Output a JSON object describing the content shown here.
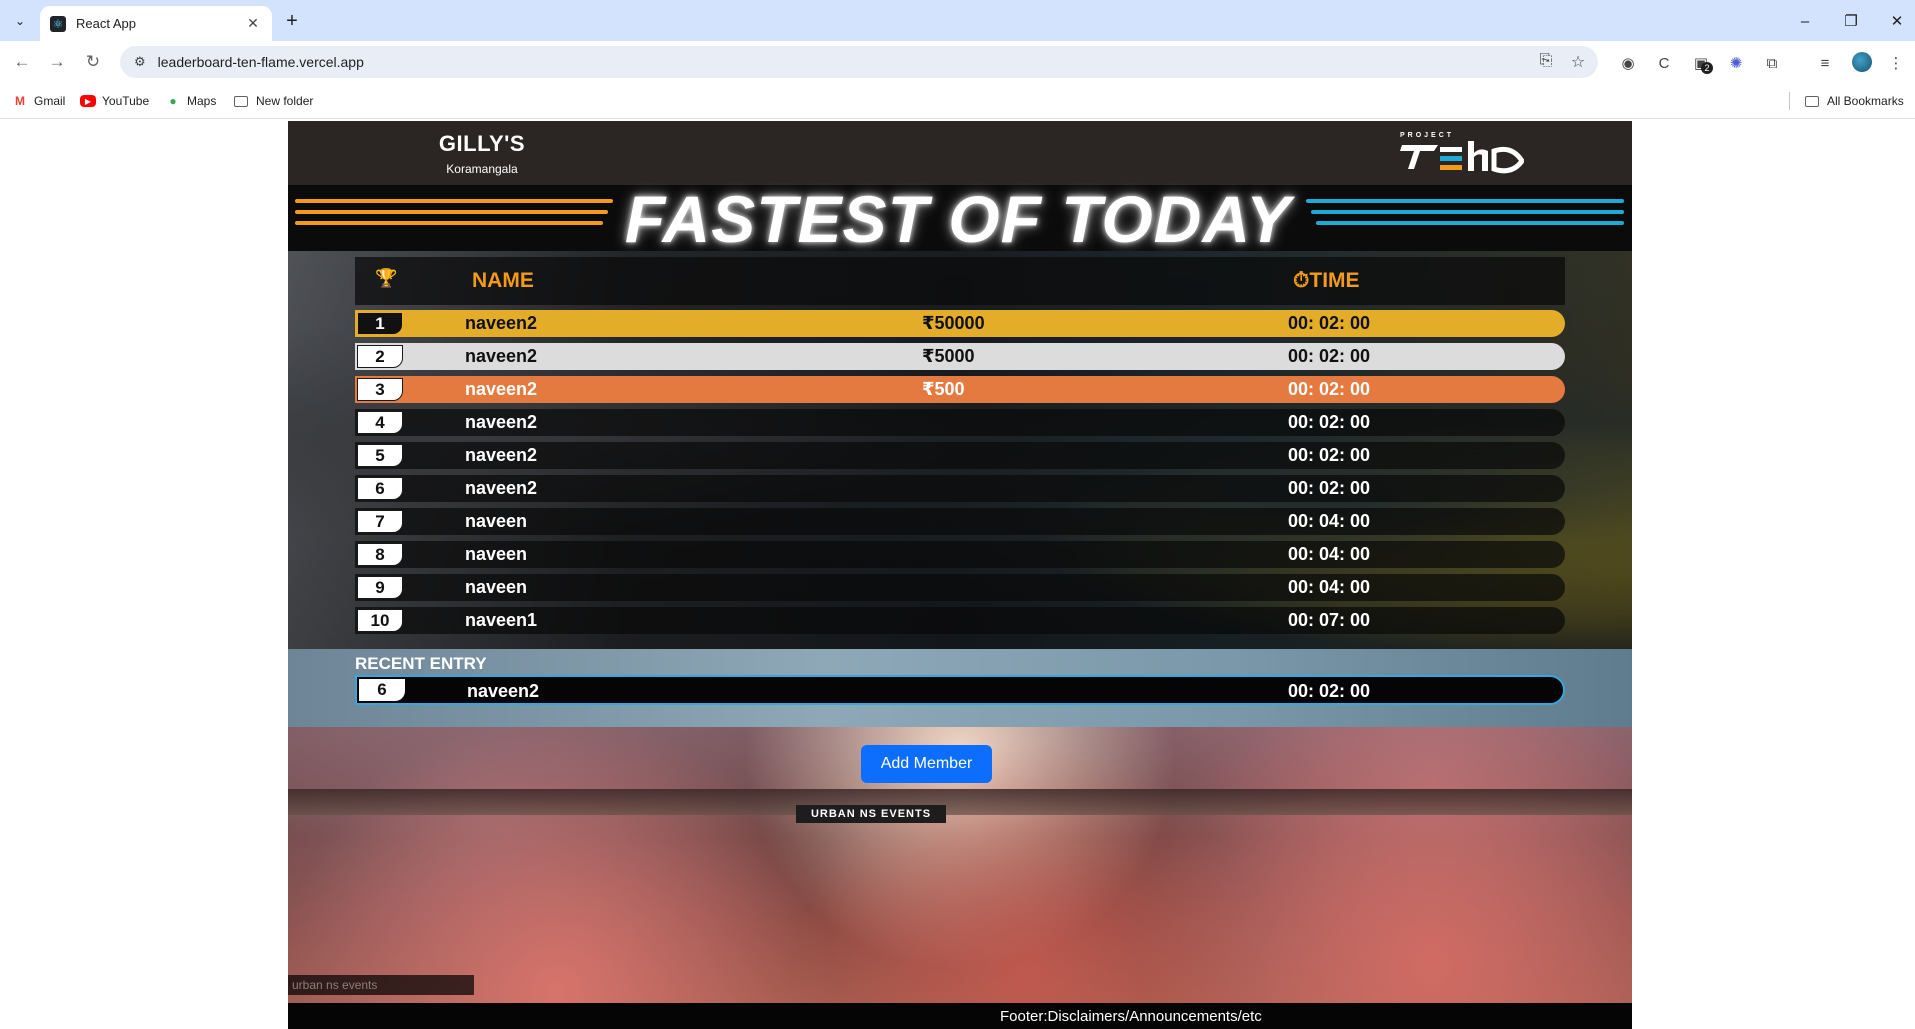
{
  "browser": {
    "tab_title": "React App",
    "url": "leaderboard-ten-flame.vercel.app",
    "bookmarks": [
      "Gmail",
      "YouTube",
      "Maps",
      "New folder"
    ],
    "all_bookmarks": "All Bookmarks",
    "extension_badge": "2"
  },
  "header": {
    "venue": "GILLY'S",
    "location": "Koramangala",
    "brand_top": "PROJECT",
    "brand_word": "TEHO"
  },
  "title": "FASTEST OF TODAY",
  "table": {
    "col_name": "NAME",
    "col_time": "TIME",
    "rows": [
      {
        "rank": "1",
        "name": "naveen2",
        "prize": "₹50000",
        "time": "00: 02: 00"
      },
      {
        "rank": "2",
        "name": "naveen2",
        "prize": "₹5000",
        "time": "00: 02: 00"
      },
      {
        "rank": "3",
        "name": "naveen2",
        "prize": "₹500",
        "time": "00: 02: 00"
      },
      {
        "rank": "4",
        "name": "naveen2",
        "prize": "",
        "time": "00: 02: 00"
      },
      {
        "rank": "5",
        "name": "naveen2",
        "prize": "",
        "time": "00: 02: 00"
      },
      {
        "rank": "6",
        "name": "naveen2",
        "prize": "",
        "time": "00: 02: 00"
      },
      {
        "rank": "7",
        "name": "naveen",
        "prize": "",
        "time": "00: 04: 00"
      },
      {
        "rank": "8",
        "name": "naveen",
        "prize": "",
        "time": "00: 04: 00"
      },
      {
        "rank": "9",
        "name": "naveen",
        "prize": "",
        "time": "00: 04: 00"
      },
      {
        "rank": "10",
        "name": "naveen1",
        "prize": "",
        "time": "00: 07: 00"
      }
    ]
  },
  "recent": {
    "title": "RECENT ENTRY",
    "rank": "6",
    "name": "naveen2",
    "time": "00: 02: 00"
  },
  "event_banner": "URBAN NS EVENTS",
  "add_member_label": "Add Member",
  "watermark": "urban ns events",
  "footer": "Footer:Disclaimers/Announcements/etc",
  "colors": {
    "gold": "#e3ad2a",
    "silver": "#dcdcdc",
    "bronze": "#e47a3f",
    "accent_orange": "#f39a1b",
    "accent_blue": "#1eaad6",
    "button_blue": "#0d6efd"
  }
}
